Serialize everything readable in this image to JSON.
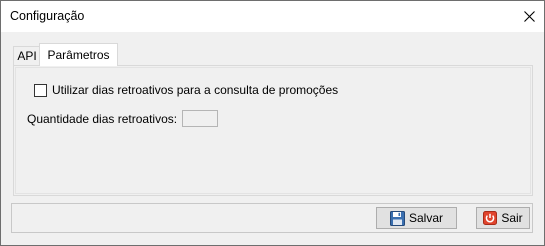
{
  "window": {
    "title": "Configuração"
  },
  "tabs": [
    {
      "label": "API",
      "active": false
    },
    {
      "label": "Parâmetros",
      "active": true
    }
  ],
  "parametros": {
    "checkbox_label": "Utilizar dias retroativos para a consulta de promoções",
    "checkbox_checked": false,
    "field_label": "Quantidade dias retroativos:",
    "field_value": ""
  },
  "footer": {
    "save_label": "Salvar",
    "exit_label": "Sair"
  },
  "icons": {
    "close": "close-icon",
    "save": "floppy-disk-icon",
    "exit": "power-icon"
  },
  "colors": {
    "exit_icon_red": "#e0442d",
    "save_icon_blue": "#3a6fb0"
  }
}
